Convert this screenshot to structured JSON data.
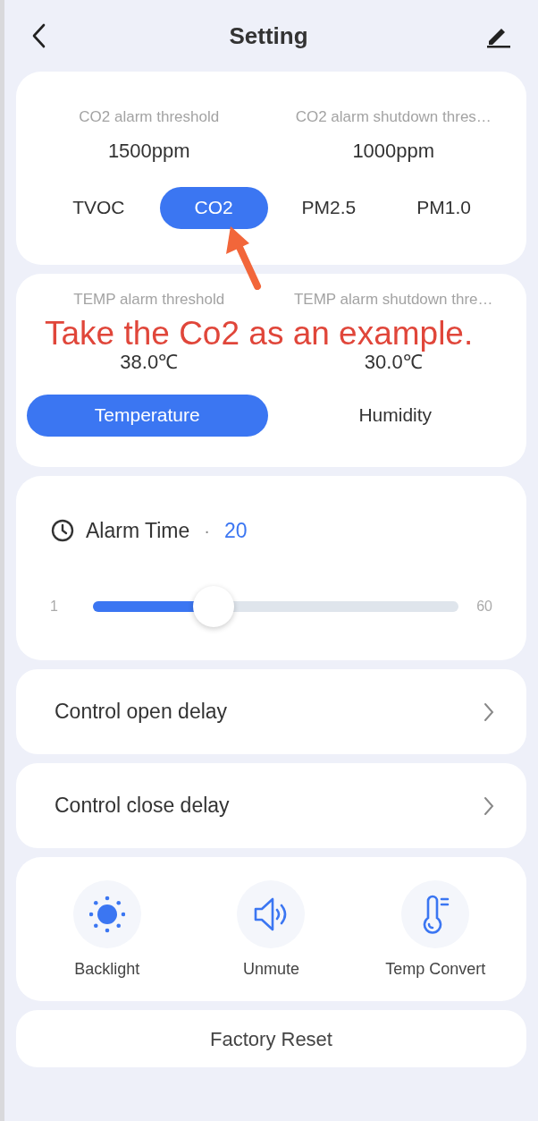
{
  "header": {
    "title": "Setting"
  },
  "gas_card": {
    "thresholds": [
      {
        "label": "CO2 alarm threshold",
        "value": "1500ppm"
      },
      {
        "label": "CO2 alarm shutdown thres…",
        "value": "1000ppm"
      }
    ],
    "tabs": [
      {
        "label": "TVOC",
        "selected": false
      },
      {
        "label": "CO2",
        "selected": true
      },
      {
        "label": "PM2.5",
        "selected": false
      },
      {
        "label": "PM1.0",
        "selected": false
      }
    ]
  },
  "climate_card": {
    "thresholds": [
      {
        "label": "TEMP alarm threshold",
        "value": "38.0℃"
      },
      {
        "label": "TEMP alarm shutdown thre…",
        "value": "30.0℃"
      }
    ],
    "tabs": [
      {
        "label": "Temperature",
        "selected": true
      },
      {
        "label": "Humidity",
        "selected": false
      }
    ]
  },
  "alarm_time": {
    "label": "Alarm Time",
    "separator": "·",
    "value": "20",
    "min": "1",
    "max": "60",
    "level": 0.33
  },
  "menu_rows": [
    {
      "label": "Control open delay"
    },
    {
      "label": "Control close delay"
    }
  ],
  "toggles": [
    {
      "kind": "sun",
      "label": "Backlight"
    },
    {
      "kind": "speaker",
      "label": "Unmute"
    },
    {
      "kind": "thermometer",
      "label": "Temp Convert"
    }
  ],
  "factory_reset": {
    "label": "Factory Reset"
  },
  "annotation": {
    "text": "Take the Co2 as an example."
  }
}
